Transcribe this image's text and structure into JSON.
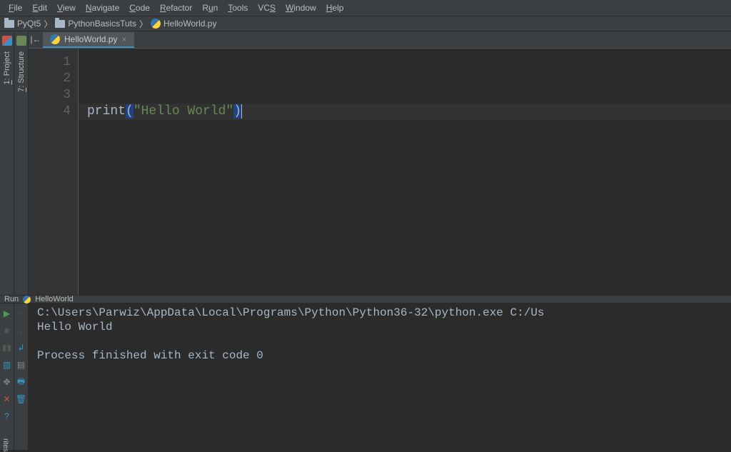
{
  "menu": [
    "File",
    "Edit",
    "View",
    "Navigate",
    "Code",
    "Refactor",
    "Run",
    "Tools",
    "VCS",
    "Window",
    "Help"
  ],
  "menu_underline_index": [
    0,
    0,
    0,
    0,
    0,
    0,
    1,
    0,
    2,
    0,
    0
  ],
  "breadcrumbs": [
    {
      "label": "PyQt5",
      "type": "folder"
    },
    {
      "label": "PythonBasicsTuts",
      "type": "folder"
    },
    {
      "label": "HelloWorld.py",
      "type": "py"
    }
  ],
  "left_toolcols": [
    {
      "label": "1: Project",
      "icon": "proj"
    },
    {
      "label": "7: Structure",
      "icon": "struct"
    }
  ],
  "editor_tab": {
    "label": "HelloWorld.py"
  },
  "code": {
    "lines": [
      "",
      "",
      "",
      "print(\"Hello World\")"
    ],
    "last_line": {
      "fn": "print",
      "open_par": "(",
      "str": "\"Hello World\"",
      "close_par": ")"
    }
  },
  "run_header": {
    "label": "Run",
    "config": "HelloWorld"
  },
  "console_lines": [
    "C:\\Users\\Parwiz\\AppData\\Local\\Programs\\Python\\Python36-32\\python.exe C:/Us",
    "Hello World",
    "",
    "Process finished with exit code 0"
  ],
  "favorites_label": "rites"
}
